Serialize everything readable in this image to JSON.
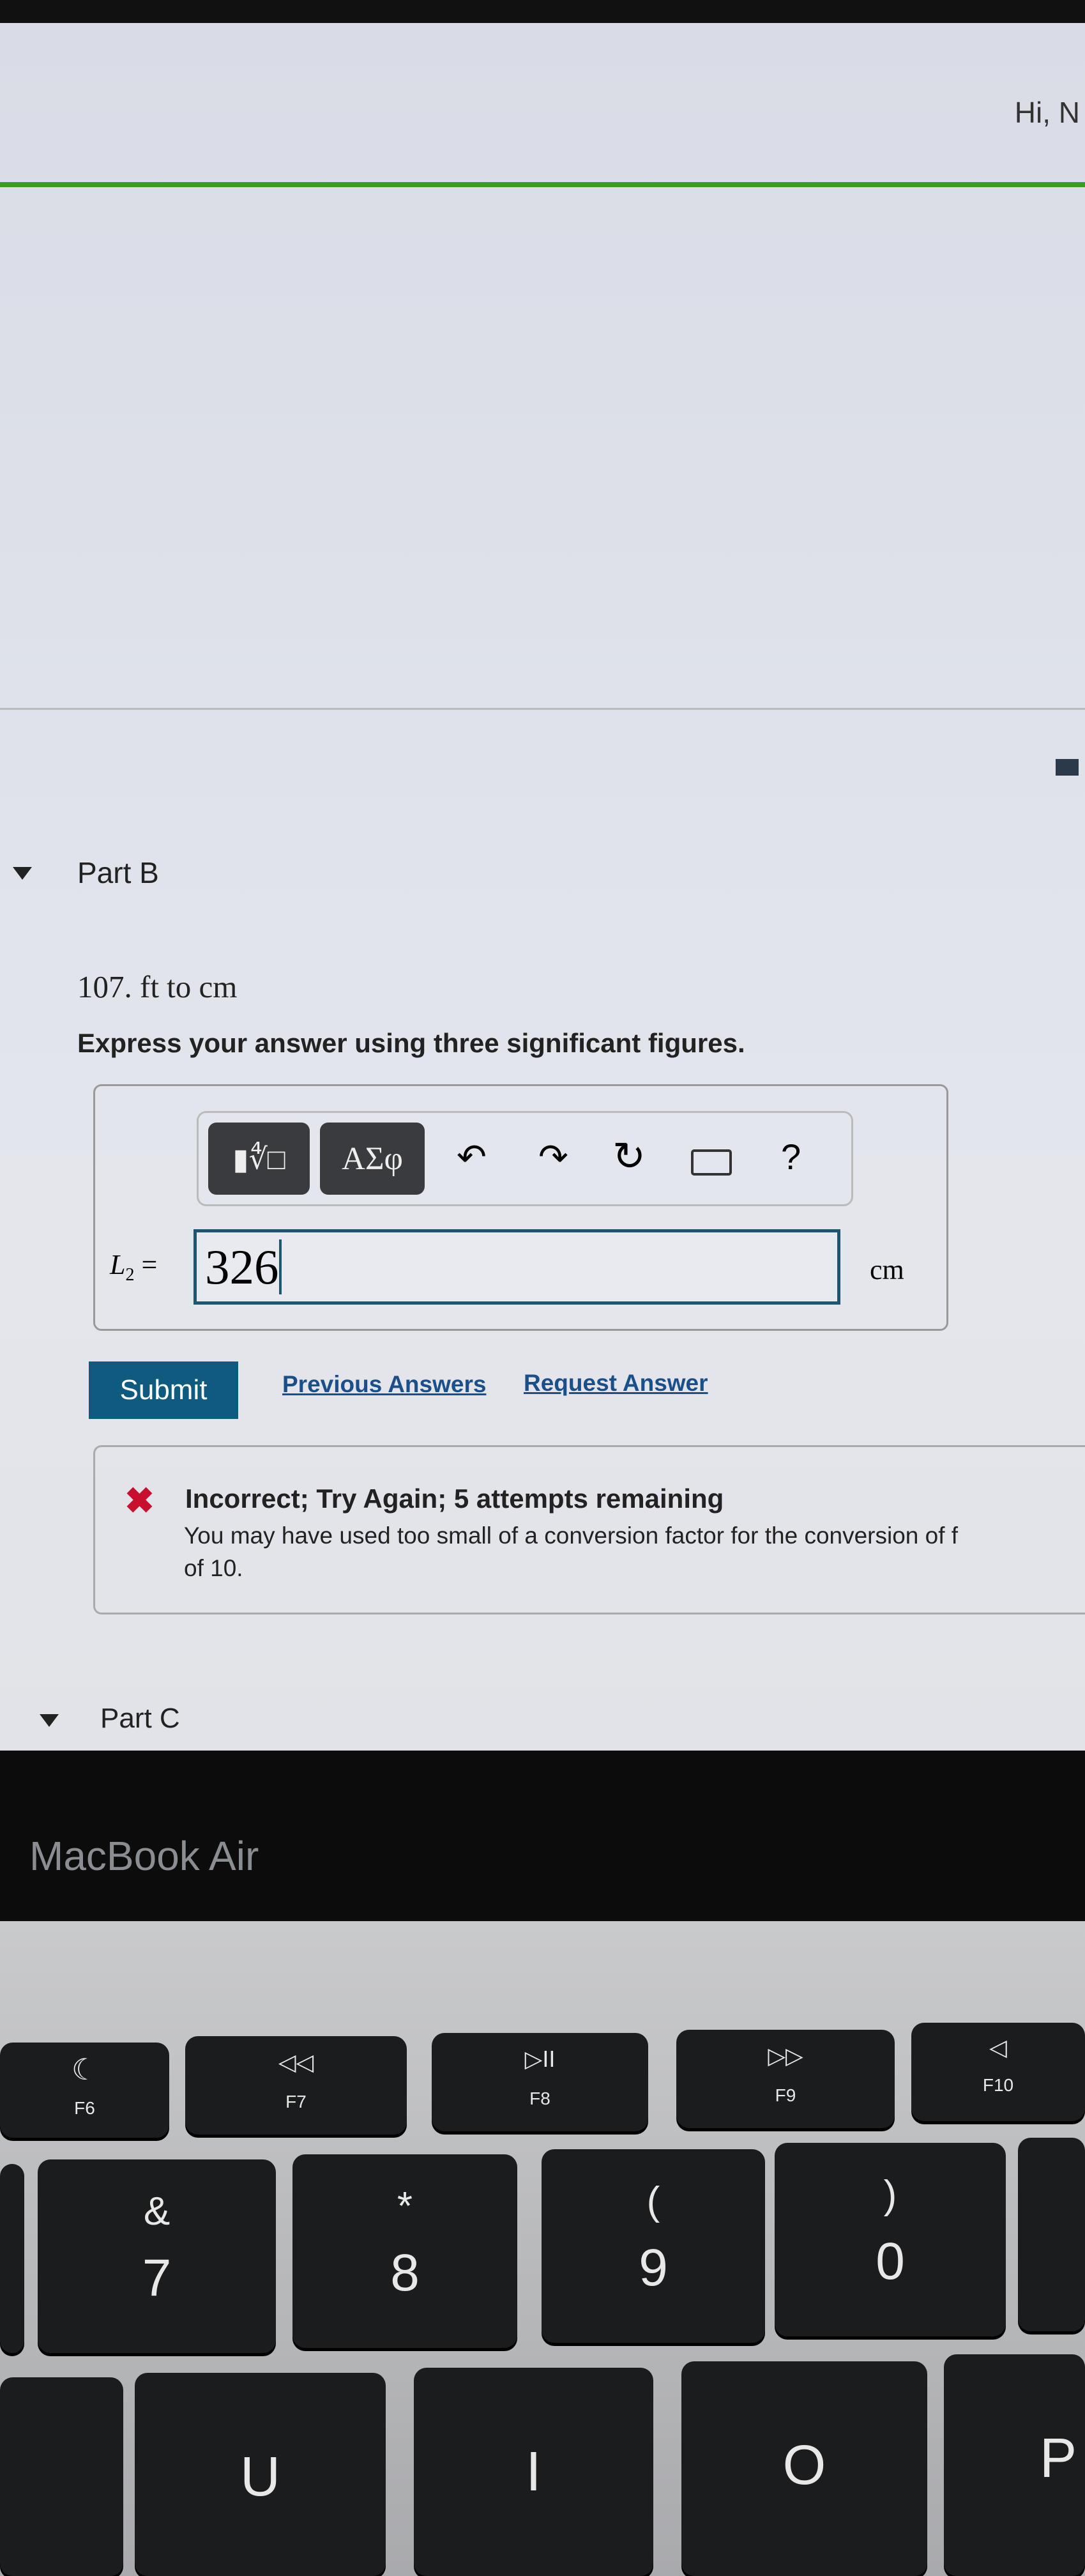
{
  "header": {
    "greeting": "Hi, N"
  },
  "part_b": {
    "label": "Part B",
    "question": "107. ft to cm",
    "instruction": "Express your answer using three significant figures."
  },
  "toolbar": {
    "templates_icon": "fraction-root-icon",
    "symbols_label": "ΑΣφ",
    "undo_icon": "undo-icon",
    "redo_icon": "redo-icon",
    "reset_icon": "reset-icon",
    "keyboard_icon": "keyboard-icon",
    "help_label": "?"
  },
  "answer": {
    "variable": "L",
    "subscript": "2",
    "equals": "=",
    "value": "326",
    "unit": "cm"
  },
  "actions": {
    "submit": "Submit",
    "previous": "Previous Answers",
    "request": "Request Answer"
  },
  "feedback": {
    "title": "Incorrect; Try Again; 5 attempts remaining",
    "message": "You may have used too small of a conversion factor for the conversion of f",
    "message_cont": "of 10.",
    "status_color": "#c8102e"
  },
  "part_c": {
    "label": "Part C"
  },
  "bezel": {
    "brand": "MacBook Air"
  },
  "keyboard": {
    "fn_row": [
      {
        "icon": "moon-icon",
        "glyph": "☾",
        "label": "F6"
      },
      {
        "icon": "rewind-icon",
        "glyph": "◁◁",
        "label": "F7"
      },
      {
        "icon": "play-pause-icon",
        "glyph": "▷II",
        "label": "F8"
      },
      {
        "icon": "fast-forward-icon",
        "glyph": "▷▷",
        "label": "F9"
      },
      {
        "icon": "mute-icon",
        "glyph": "◁",
        "label": "F10"
      }
    ],
    "num_row": [
      {
        "top": "&",
        "main": "7"
      },
      {
        "top": "*",
        "main": "8"
      },
      {
        "top": "(",
        "main": "9"
      },
      {
        "top": ")",
        "main": "0"
      }
    ],
    "letter_row": [
      "U",
      "I",
      "O",
      "P"
    ]
  },
  "colors": {
    "accent": "#0f5b7f",
    "green_rule": "#3a9a2a",
    "link": "#1a4f8a"
  }
}
